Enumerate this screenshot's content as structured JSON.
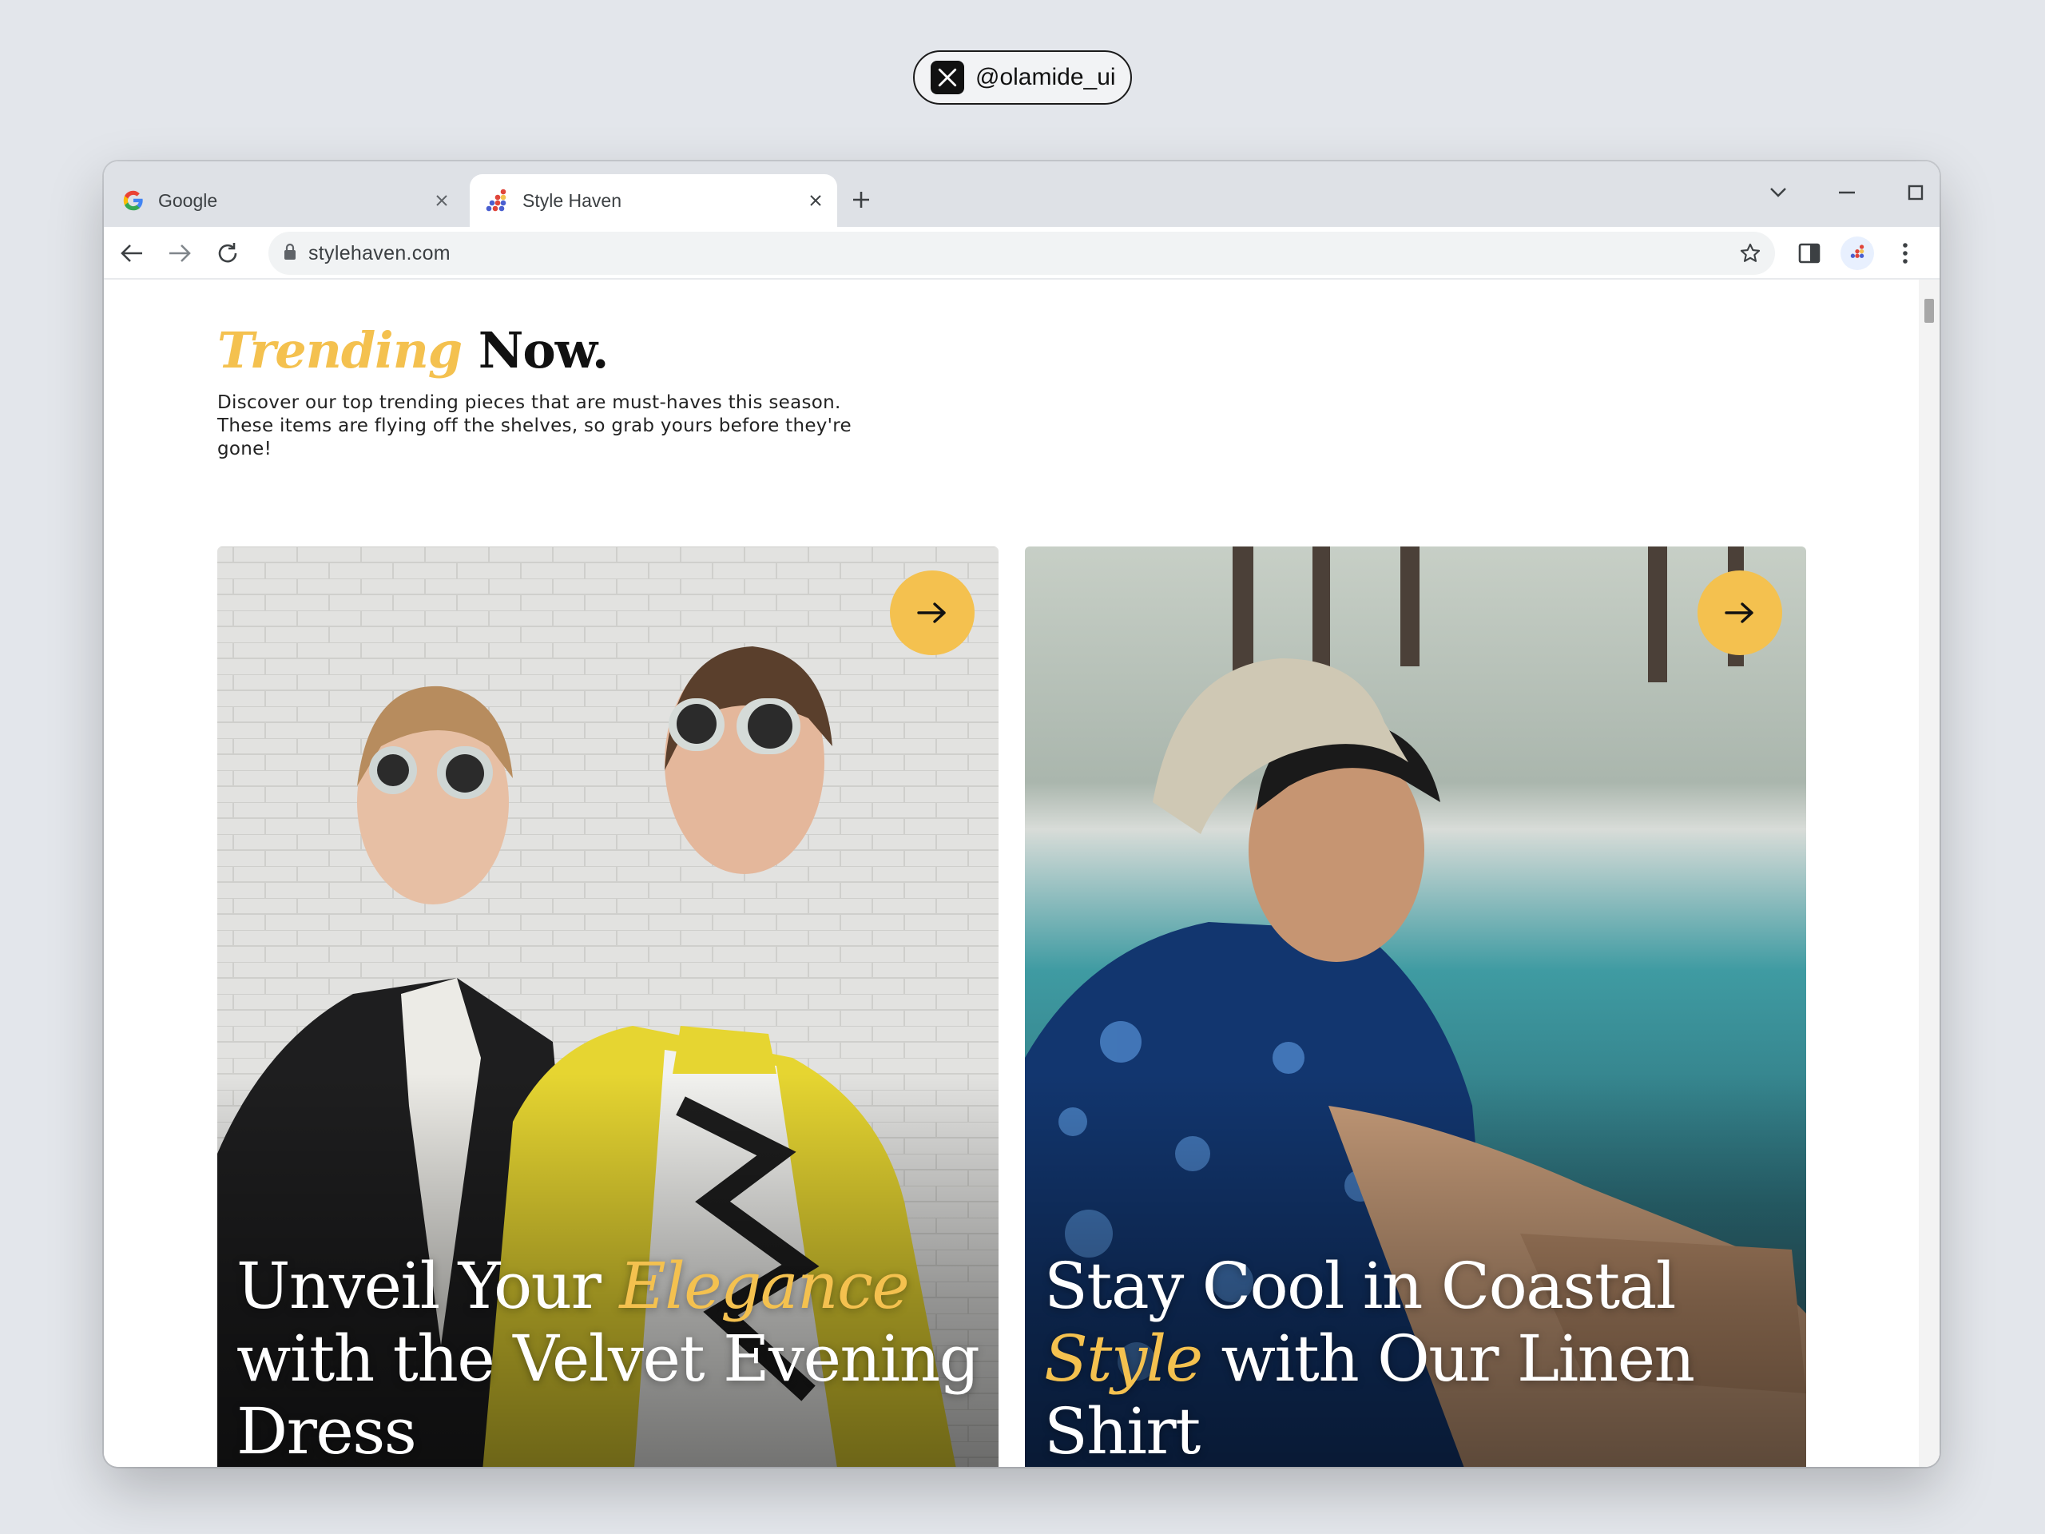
{
  "badge": {
    "handle": "@olamide_ui",
    "icon": "x-logo-icon"
  },
  "browser": {
    "tabs": [
      {
        "label": "Google",
        "icon": "google-icon",
        "active": false
      },
      {
        "label": "Style Haven",
        "icon": "style-haven-icon",
        "active": true
      }
    ],
    "url": "stylehaven.com"
  },
  "page": {
    "headline_accent": "Trending",
    "headline_rest": " Now.",
    "intro": "Discover our top trending pieces that are must-haves this season. These items are flying off the shelves, so grab yours before they're gone!",
    "cards": [
      {
        "title_before": "Unveil Your ",
        "title_accent": "Elegance",
        "title_after": " with the Velvet Evening Dress",
        "action_icon": "arrow-right-icon"
      },
      {
        "title_before": "Stay Cool in Coastal ",
        "title_accent": "Style",
        "title_after": " with Our Linen Shirt",
        "action_icon": "arrow-right-icon"
      }
    ]
  },
  "colors": {
    "accent": "#f4c14f",
    "background": "#e3e6eb",
    "tab_strip": "#dee1e6"
  }
}
